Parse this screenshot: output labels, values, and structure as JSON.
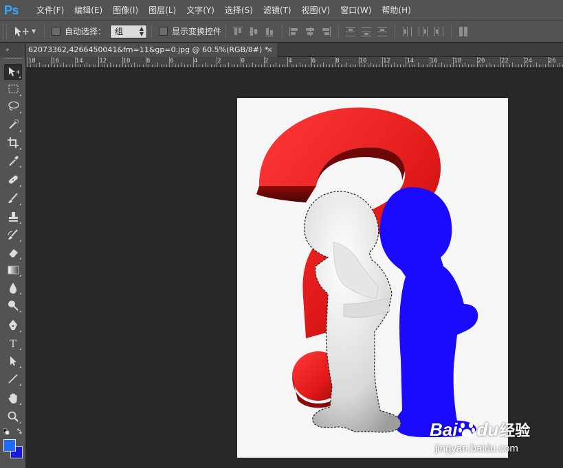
{
  "app": {
    "logo": "Ps",
    "menu": [
      "文件(F)",
      "编辑(E)",
      "图像(I)",
      "图层(L)",
      "文字(Y)",
      "选择(S)",
      "滤镜(T)",
      "视图(V)",
      "窗口(W)",
      "帮助(H)"
    ]
  },
  "options": {
    "auto_select_label": "自动选择：",
    "auto_select_checked": false,
    "auto_select_value": "组",
    "show_transform_label": "显示变换控件",
    "show_transform_checked": false
  },
  "document": {
    "tab_title": "62073362,4266450041&fm=11&gp=0.jpg @ 60.5%(RGB/8#) *",
    "close_glyph": "×",
    "panel_collapse_glyph": "»"
  },
  "ruler": {
    "labels": [
      "18",
      "16",
      "14",
      "12",
      "10",
      "8",
      "6",
      "4",
      "2",
      "0",
      "2",
      "4",
      "6",
      "8",
      "10",
      "12",
      "14",
      "16",
      "18",
      "20",
      "22",
      "24",
      "26"
    ]
  },
  "tools": [
    {
      "name": "move-tool",
      "icon": "move-icon"
    },
    {
      "name": "marquee-tool",
      "icon": "rect-marquee-icon"
    },
    {
      "name": "lasso-tool",
      "icon": "lasso-icon"
    },
    {
      "name": "quick-select-tool",
      "icon": "quick-select-icon"
    },
    {
      "name": "crop-tool",
      "icon": "crop-icon"
    },
    {
      "name": "eyedropper-tool",
      "icon": "eyedropper-icon"
    },
    {
      "name": "healing-tool",
      "icon": "bandage-icon"
    },
    {
      "name": "brush-tool",
      "icon": "brush-icon"
    },
    {
      "name": "stamp-tool",
      "icon": "stamp-icon"
    },
    {
      "name": "history-brush-tool",
      "icon": "history-brush-icon"
    },
    {
      "name": "eraser-tool",
      "icon": "eraser-icon"
    },
    {
      "name": "gradient-tool",
      "icon": "gradient-icon"
    },
    {
      "name": "blur-tool",
      "icon": "drop-icon"
    },
    {
      "name": "dodge-tool",
      "icon": "dodge-icon"
    },
    {
      "name": "pen-tool",
      "icon": "pen-icon"
    },
    {
      "name": "type-tool",
      "icon": "type-icon",
      "glyph": "T"
    },
    {
      "name": "path-select-tool",
      "icon": "arrow-icon"
    },
    {
      "name": "line-tool",
      "icon": "line-icon"
    },
    {
      "name": "hand-tool",
      "icon": "hand-icon"
    },
    {
      "name": "zoom-tool",
      "icon": "zoom-icon"
    }
  ],
  "colors": {
    "foreground": "#1e6bff",
    "background": "#1a1add",
    "question_mark": "#e02020",
    "blue_figure": "#1a0bff",
    "accent": "#31a8ff"
  },
  "watermark": {
    "brand_a": "Bai",
    "brand_b": "du",
    "suffix": "经验",
    "url": "jingyan.baidu.com"
  }
}
